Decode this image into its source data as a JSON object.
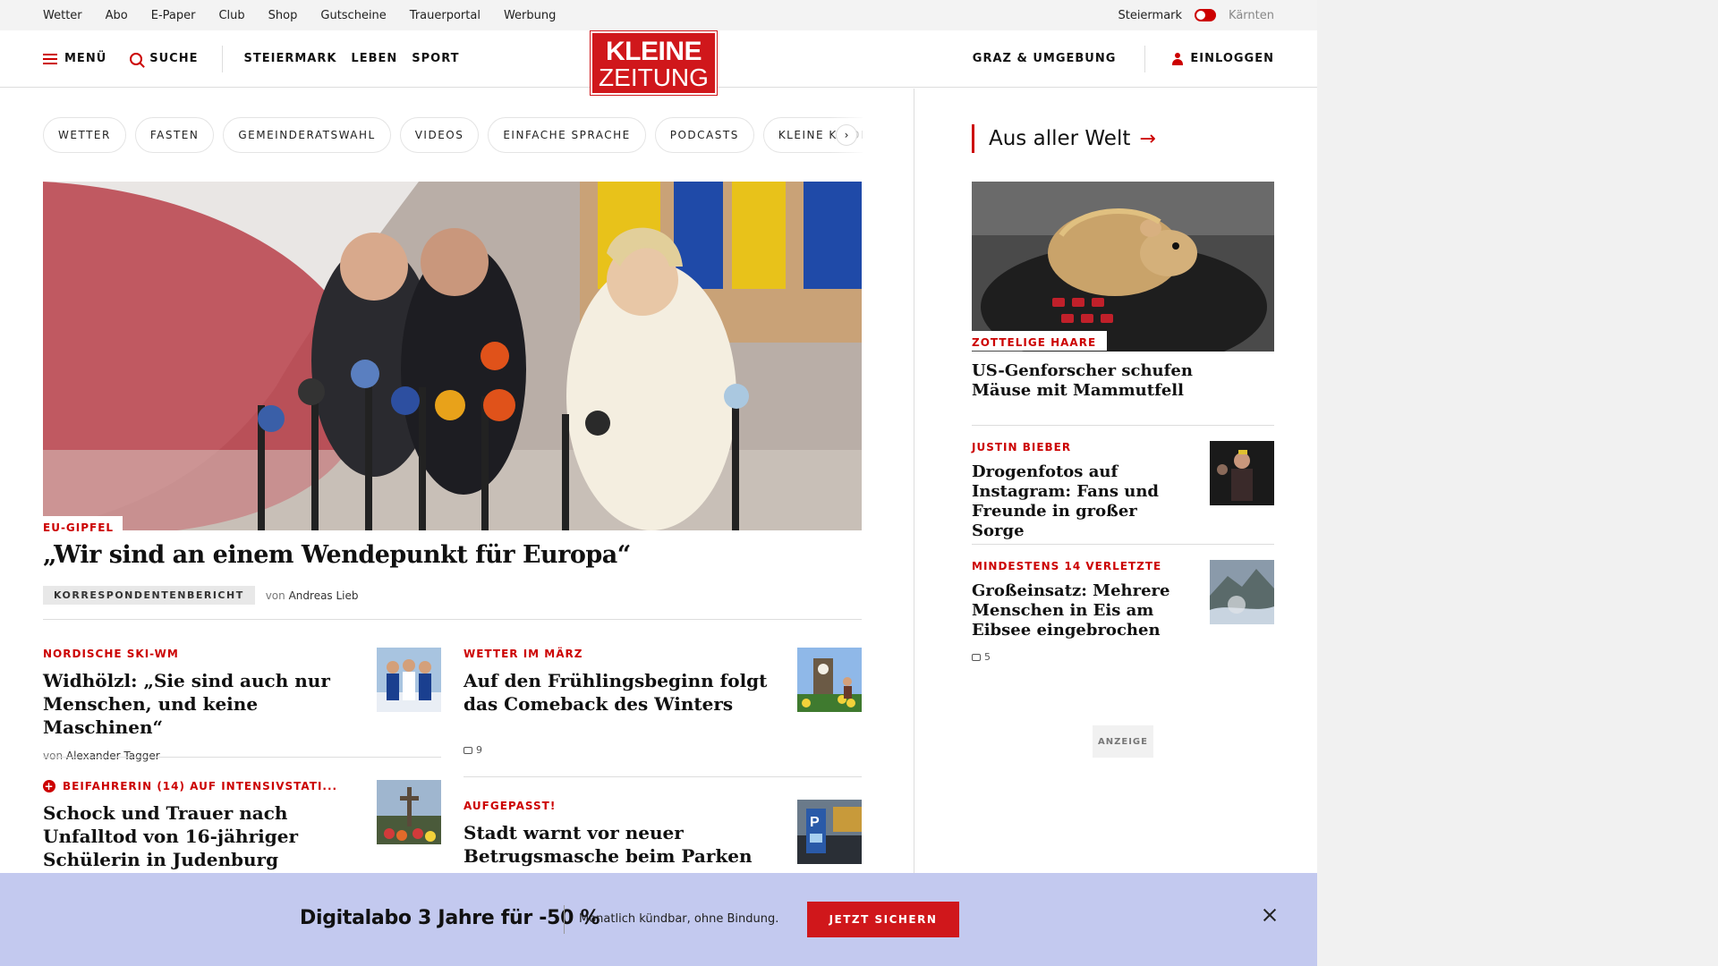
{
  "utilbar": {
    "links": [
      "Wetter",
      "Abo",
      "E-Paper",
      "Club",
      "Shop",
      "Gutscheine",
      "Trauerportal",
      "Werbung"
    ],
    "region_active": "Steiermark",
    "region_other": "Kärnten"
  },
  "header": {
    "menu_label": "MENÜ",
    "search_label": "SUCHE",
    "nav": [
      "STEIERMARK",
      "LEBEN",
      "SPORT"
    ],
    "logo_line1": "KLEINE",
    "logo_line2": "ZEITUNG",
    "region_link": "GRAZ & UMGEBUNG",
    "login_label": "EINLOGGEN"
  },
  "chips": [
    "WETTER",
    "FASTEN",
    "GEMEINDERATSWAHL",
    "VIDEOS",
    "EINFACHE SPRACHE",
    "PODCASTS",
    "KLEINE KINDE"
  ],
  "hero": {
    "kicker": "EU-GIPFEL",
    "title": "„Wir sind an einem Wendepunkt für Europa“",
    "badge": "KORRESPONDENTENBERICHT",
    "by": "von",
    "author": "Andreas Lieb"
  },
  "articles": [
    {
      "kicker": "NORDISCHE SKI-WM",
      "title": "Widhölzl: „Sie sind auch nur Menschen, und keine Maschinen“",
      "by": "von",
      "author": "Alexander Tagger"
    },
    {
      "kicker": "WETTER IM MÄRZ",
      "title": "Auf den Frühlingsbeginn folgt das Comeback des Winters",
      "comments": "9"
    },
    {
      "kicker": "BEIFAHRERIN (14) AUF INTENSIVSTATI...",
      "title": "Schock und Trauer nach Unfalltod von 16-jähriger Schülerin in Judenburg"
    },
    {
      "kicker": "AUFGEPASST!",
      "title": "Stadt warnt vor neuer Betrugsmasche beim Parken"
    }
  ],
  "sidebar": {
    "heading": "Aus aller Welt",
    "items": [
      {
        "kicker": "ZOTTELIGE HAARE",
        "title": "US-Genforscher schufen Mäuse mit Mammutfell"
      },
      {
        "kicker": "JUSTIN BIEBER",
        "title": "Drogenfotos auf Instagram: Fans und Freunde in großer Sorge"
      },
      {
        "kicker": "MINDESTENS 14 VERLETZTE",
        "title": "Großeinsatz: Mehrere Menschen in Eis am Eibsee eingebrochen",
        "comments": "5"
      }
    ],
    "ad_label": "ANZEIGE"
  },
  "promo": {
    "title": "Digitalabo 3 Jahre für -50 %",
    "subtitle": "Monatlich kündbar, ohne Bindung.",
    "button": "JETZT SICHERN"
  },
  "colors": {
    "brand_red": "#d0171b",
    "promo_bg": "#c3c9ef"
  }
}
